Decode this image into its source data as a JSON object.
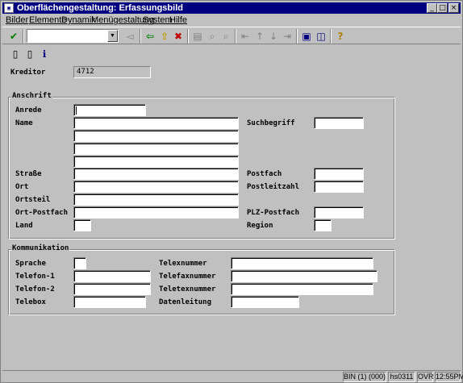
{
  "window": {
    "title": "Oberflächengestaltung: Erfassungsbild",
    "app_icon": "sap-window-icon",
    "minimize_glyph": "_",
    "maximize_glyph": "□",
    "close_glyph": "×"
  },
  "menu": {
    "items": [
      {
        "label": "Bilder"
      },
      {
        "label": "Elemente"
      },
      {
        "label": "Dynamik"
      },
      {
        "label": "Menügestaltung"
      },
      {
        "label": "System"
      },
      {
        "label": "Hilfe"
      }
    ]
  },
  "toolbar": {
    "command_field_value": "",
    "icons": [
      "enter-check-icon",
      "back-arrow-icon",
      "up-arrow-icon",
      "cancel-x-icon",
      "print-icon",
      "find-icon",
      "find-next-icon",
      "first-page-icon",
      "prev-page-icon",
      "next-page-icon",
      "last-page-icon",
      "create-session-icon",
      "shortcut-icon",
      "help-icon"
    ]
  },
  "app_toolbar": {
    "icons": [
      "insert-line-icon",
      "delete-line-icon",
      "info-icon"
    ]
  },
  "header_fields": {
    "kreditor_label": "Kreditor",
    "kreditor_value": "4712"
  },
  "anschrift": {
    "title": "Anschrift",
    "anrede_label": "Anrede",
    "name_label": "Name",
    "strasse_label": "Straße",
    "ort_label": "Ort",
    "ortsteil_label": "Ortsteil",
    "ort_postfach_label": "Ort-Postfach",
    "land_label": "Land",
    "suchbegriff_label": "Suchbegriff",
    "postfach_label": "Postfach",
    "postleitzahl_label": "Postleitzahl",
    "plz_postfach_label": "PLZ-Postfach",
    "region_label": "Region"
  },
  "kommunikation": {
    "title": "Kommunikation",
    "sprache_label": "Sprache",
    "telefon1_label": "Telefon-1",
    "telefon2_label": "Telefon-2",
    "telebox_label": "Telebox",
    "telexnummer_label": "Telexnummer",
    "telefaxnummer_label": "Telefaxnummer",
    "teletexnummer_label": "Teletexnummer",
    "datenleitung_label": "Datenleitung"
  },
  "statusbar": {
    "mode": "BIN (1) (000)",
    "server": "hs0311",
    "overwrite": "OVR",
    "time": "12:55PM"
  }
}
